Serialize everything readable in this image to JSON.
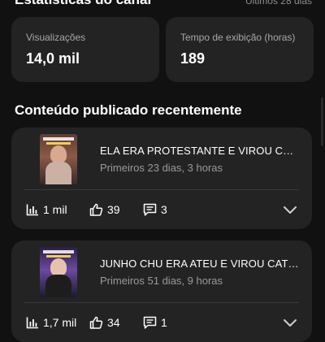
{
  "header": {
    "title": "Estatísticas do canal",
    "range": "Últimos 28 dias"
  },
  "stats": [
    {
      "label": "Visualizações",
      "value": "14,0 mil"
    },
    {
      "label": "Tempo de exibição (horas)",
      "value": "189"
    }
  ],
  "recent": {
    "title": "Conteúdo publicado recentemente",
    "items": [
      {
        "title": "ELA ERA PROTESTANTE E VIROU CATÓLICA",
        "subtitle": "Primeiros 23 dias, 3 horas",
        "views": "1 mil",
        "likes": "39",
        "comments": "3",
        "icons": {
          "views": "bar-chart-icon",
          "likes": "thumbs-up-icon",
          "comments": "comment-icon",
          "expand": "chevron-down-icon"
        }
      },
      {
        "title": "JUNHO CHU ERA ATEU E VIROU CATÓLICO",
        "subtitle": "Primeiros 51 dias, 9 horas",
        "views": "1,7 mil",
        "likes": "34",
        "comments": "1",
        "icons": {
          "views": "bar-chart-icon",
          "likes": "thumbs-up-icon",
          "comments": "comment-icon",
          "expand": "chevron-down-icon"
        }
      }
    ]
  },
  "colors": {
    "background": "#111111",
    "card": "#232323",
    "text_primary": "#ffffff",
    "text_secondary": "#9a9a9a"
  }
}
